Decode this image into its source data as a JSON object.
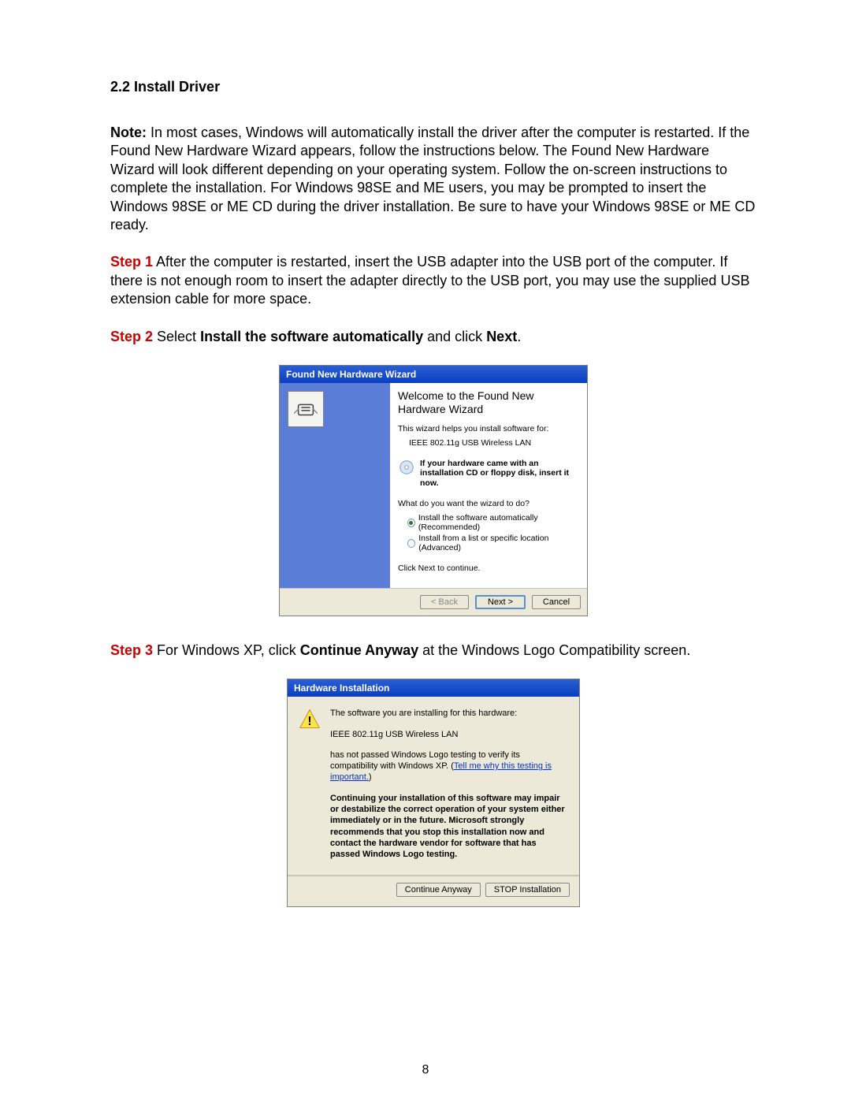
{
  "section_heading": "2.2 Install Driver",
  "note_label": "Note:",
  "note_text": " In most cases, Windows will automatically install the driver after the computer is restarted. If the Found New Hardware Wizard appears, follow the instructions below. The Found New Hardware Wizard will look different depending on your operating system. Follow the on-screen instructions to complete the installation. For Windows 98SE and ME users, you may be prompted to insert the Windows 98SE or ME CD during the driver installation. Be sure to have your Windows 98SE or ME CD ready.",
  "step1_label": "Step 1",
  "step1_text": " After the computer is restarted, insert the USB adapter into the USB port of the computer. If there is not enough room to insert the adapter directly to the USB port, you may use the supplied USB extension cable for more space.",
  "step2_label": "Step 2",
  "step2_pre": " Select ",
  "step2_bold1": "Install the software automatically",
  "step2_mid": " and click ",
  "step2_bold2": "Next",
  "step2_post": ".",
  "step3_label": "Step 3",
  "step3_pre": " For Windows XP, click ",
  "step3_bold": "Continue Anyway",
  "step3_post": " at the Windows Logo Compatibility screen.",
  "page_number": "8",
  "dlg1": {
    "title": "Found New Hardware Wizard",
    "welcome": "Welcome to the Found New Hardware Wizard",
    "helps_line": "This wizard helps you install software for:",
    "device": "IEEE 802.11g USB Wireless LAN",
    "cd_text": "If your hardware came with an installation CD or floppy disk, insert it now.",
    "question": "What do you want the wizard to do?",
    "opt1": "Install the software automatically (Recommended)",
    "opt2": "Install from a list or specific location (Advanced)",
    "continue_line": "Click Next to continue.",
    "btn_back": "< Back",
    "btn_next": "Next >",
    "btn_cancel": "Cancel"
  },
  "dlg2": {
    "title": "Hardware Installation",
    "line1": "The software you are installing for this hardware:",
    "device": "IEEE 802.11g USB Wireless LAN",
    "line2a": "has not passed Windows Logo testing to verify its compatibility with Windows XP. (",
    "link": "Tell me why this testing is important.",
    "line2b": ")",
    "bold_block": "Continuing your installation of this software may impair or destabilize the correct operation of your system either immediately or in the future. Microsoft strongly recommends that you stop this installation now and contact the hardware vendor for software that has passed Windows Logo testing.",
    "btn_continue": "Continue Anyway",
    "btn_stop": "STOP Installation"
  }
}
